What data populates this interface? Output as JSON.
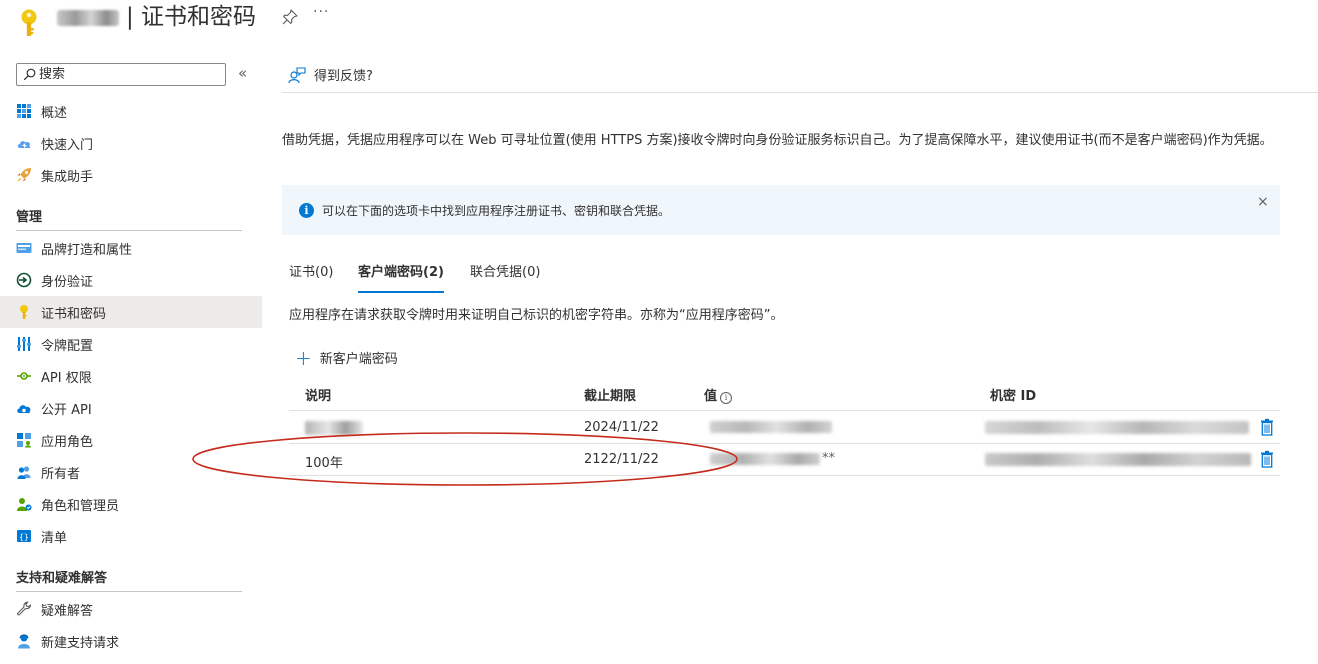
{
  "header": {
    "title": "| 证书和密码",
    "icons": {
      "app": "key-icon",
      "pin": "pin-icon",
      "more": "more-icon"
    },
    "more_label": "···"
  },
  "sidebar": {
    "search_placeholder": "搜索",
    "collapse_label": "«",
    "items_top": [
      {
        "label": "概述",
        "icon": "overview-grid-icon"
      },
      {
        "label": "快速入门",
        "icon": "cloud-quickstart-icon"
      },
      {
        "label": "集成助手",
        "icon": "rocket-icon"
      }
    ],
    "section_manage": "管理",
    "items_manage": [
      {
        "label": "品牌打造和属性",
        "icon": "branding-icon"
      },
      {
        "label": "身份验证",
        "icon": "authentication-icon"
      },
      {
        "label": "证书和密码",
        "icon": "key-icon",
        "active": true
      },
      {
        "label": "令牌配置",
        "icon": "token-config-icon"
      },
      {
        "label": "API 权限",
        "icon": "api-permissions-icon"
      },
      {
        "label": "公开 API",
        "icon": "expose-api-icon"
      },
      {
        "label": "应用角色",
        "icon": "app-roles-icon"
      },
      {
        "label": "所有者",
        "icon": "owners-icon"
      },
      {
        "label": "角色和管理员",
        "icon": "roles-admins-icon"
      },
      {
        "label": "清单",
        "icon": "manifest-icon"
      }
    ],
    "section_support": "支持和疑难解答",
    "items_support": [
      {
        "label": "疑难解答",
        "icon": "wrench-icon"
      },
      {
        "label": "新建支持请求",
        "icon": "support-request-icon"
      }
    ]
  },
  "main": {
    "feedback_label": "得到反馈?",
    "description": "借助凭据，凭据应用程序可以在 Web 可寻址位置(使用 HTTPS 方案)接收令牌时向身份验证服务标识自己。为了提高保障水平，建议使用证书(而不是客户端密码)作为凭据。",
    "info_text": "可以在下面的选项卡中找到应用程序注册证书、密钥和联合凭据。",
    "info_close": "×",
    "tabs": [
      {
        "label": "证书(0)"
      },
      {
        "label": "客户端密码(2)",
        "active": true
      },
      {
        "label": "联合凭据(0)"
      }
    ],
    "tab_description": "应用程序在请求获取令牌时用来证明自己标识的机密字符串。亦称为“应用程序密码”。",
    "new_secret_label": "新客户端密码",
    "new_secret_plus": "+",
    "table": {
      "columns": [
        "说明",
        "截止期限",
        "值",
        "机密 ID"
      ],
      "value_info": "i",
      "rows": [
        {
          "description": "",
          "expires": "2024/11/22",
          "value": "",
          "secret_id": ""
        },
        {
          "description": "100年",
          "expires": "2122/11/22",
          "value_suffix": "**",
          "secret_id": ""
        }
      ]
    }
  },
  "colors": {
    "accent": "#0078d4",
    "info_bg": "#eff6fc",
    "active_nav": "#edebe9",
    "annotation": "#c42b1c",
    "key_yellow": "#f2c811"
  }
}
